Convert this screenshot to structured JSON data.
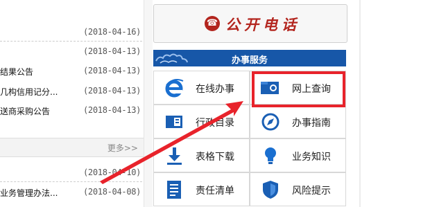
{
  "news_top": [
    {
      "title": "",
      "date": "(2018-04-16)"
    },
    {
      "title": "",
      "date": "(2018-04-13)"
    },
    {
      "title": "结果公告",
      "date": "(2018-04-13)"
    },
    {
      "title": "几构信用记分...",
      "date": "(2018-04-13)"
    },
    {
      "title": "送商采购公告",
      "date": "(2018-04-13)"
    }
  ],
  "more": {
    "label": "更多>>"
  },
  "news_bottom": [
    {
      "title": "",
      "date": "(2018-04-10)"
    },
    {
      "title": "业务管理办法...",
      "date": "(2018-04-08)"
    }
  ],
  "phone": {
    "label": "公开电话",
    "icon": "telephone-icon",
    "color": "#b3251e"
  },
  "service": {
    "title": "办事服务",
    "header_color": "#1757a8",
    "tiles": [
      {
        "label": "在线办事",
        "icon": "ie-icon"
      },
      {
        "label": "网上查询",
        "icon": "search-folder-icon"
      },
      {
        "label": "行政目录",
        "icon": "catalog-icon"
      },
      {
        "label": "办事指南",
        "icon": "compass-icon"
      },
      {
        "label": "表格下载",
        "icon": "download-icon"
      },
      {
        "label": "业务知识",
        "icon": "lightbulb-icon"
      },
      {
        "label": "责任清单",
        "icon": "document-list-icon"
      },
      {
        "label": "风险提示",
        "icon": "shield-icon"
      }
    ]
  },
  "annotation": {
    "highlight_color": "#e8232b"
  }
}
